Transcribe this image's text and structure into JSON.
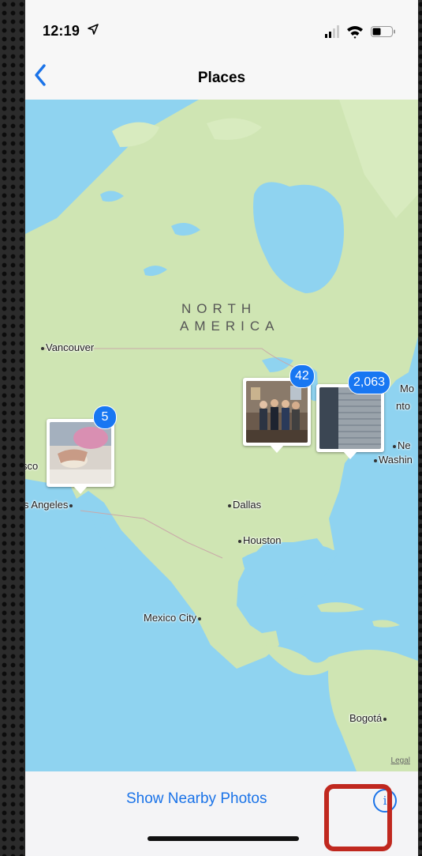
{
  "status_bar": {
    "time": "12:19",
    "icons": [
      "location-arrow-icon",
      "cellular-signal-icon",
      "wifi-icon",
      "battery-icon"
    ]
  },
  "nav": {
    "title": "Places",
    "back_icon": "chevron-left-icon"
  },
  "map": {
    "continent_label_line1": "NORTH",
    "continent_label_line2": "AMERICA",
    "cities": {
      "vancouver": "Vancouver",
      "san_francisco": "sco",
      "los_angeles": "s Angeles",
      "dallas": "Dallas",
      "houston": "Houston",
      "mexico_city": "Mexico City",
      "bogota": "Bogotá",
      "washington": "Washin",
      "toronto": "nto",
      "montreal": "Mo",
      "new_york": "Ne"
    },
    "clusters": [
      {
        "region": "west-coast",
        "count": "5"
      },
      {
        "region": "midwest",
        "count": "42"
      },
      {
        "region": "northeast",
        "count": "2,063"
      }
    ],
    "legal": "Legal"
  },
  "toolbar": {
    "show_nearby_label": "Show Nearby Photos",
    "info_icon": "info-circle-icon",
    "info_glyph": "i"
  },
  "colors": {
    "accent": "#1a73e8",
    "badge": "#1877f2",
    "water": "#8fd3f0",
    "land": "#cfe5b3",
    "highlight": "#c0281f"
  }
}
